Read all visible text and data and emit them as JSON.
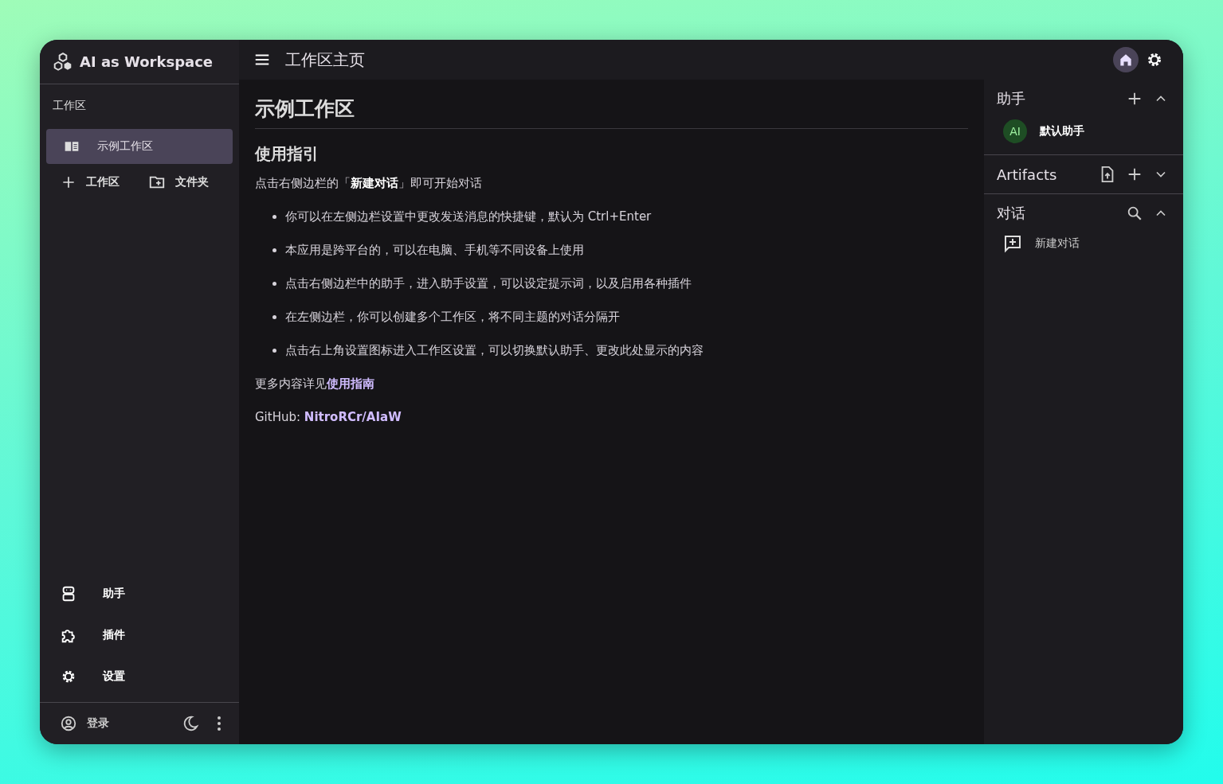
{
  "sidebar": {
    "app_title": "AI as Workspace",
    "section_label": "工作区",
    "workspaces": [
      {
        "label": "示例工作区",
        "selected": true
      }
    ],
    "add_actions": [
      "工作区",
      "文件夹"
    ],
    "nav": [
      "助手",
      "插件",
      "设置"
    ],
    "login": "登录"
  },
  "header": {
    "title": "工作区主页"
  },
  "content": {
    "heading": "示例工作区",
    "subheading": "使用指引",
    "intro": "点击右侧边栏的「**新建对话**」即可开始对话",
    "bullets": [
      "你可以在左侧边栏设置中更改发送消息的快捷键，默认为 Ctrl+Enter",
      "本应用是跨平台的，可以在电脑、手机等不同设备上使用",
      "点击右侧边栏中的助手，进入助手设置，可以设定提示词，以及启用各种插件",
      "在左侧边栏，你可以创建多个工作区，将不同主题的对话分隔开",
      "点击右上角设置图标进入工作区设置，可以切换默认助手、更改此处显示的内容"
    ],
    "more_text": "更多内容详见",
    "more_link": "使用指南",
    "github_label": "GitHub:",
    "github_link": "NitroRCr/AIaW"
  },
  "right_panel": {
    "sections": [
      {
        "title": "助手",
        "expanded": true,
        "items": [
          {
            "kind": "assistant",
            "avatar": "AI",
            "label": "默认助手"
          }
        ]
      },
      {
        "title": "Artifacts",
        "expanded": false
      },
      {
        "title": "对话",
        "expanded": true,
        "items": [
          {
            "kind": "new-chat",
            "label": "新建对话"
          }
        ]
      }
    ]
  }
}
